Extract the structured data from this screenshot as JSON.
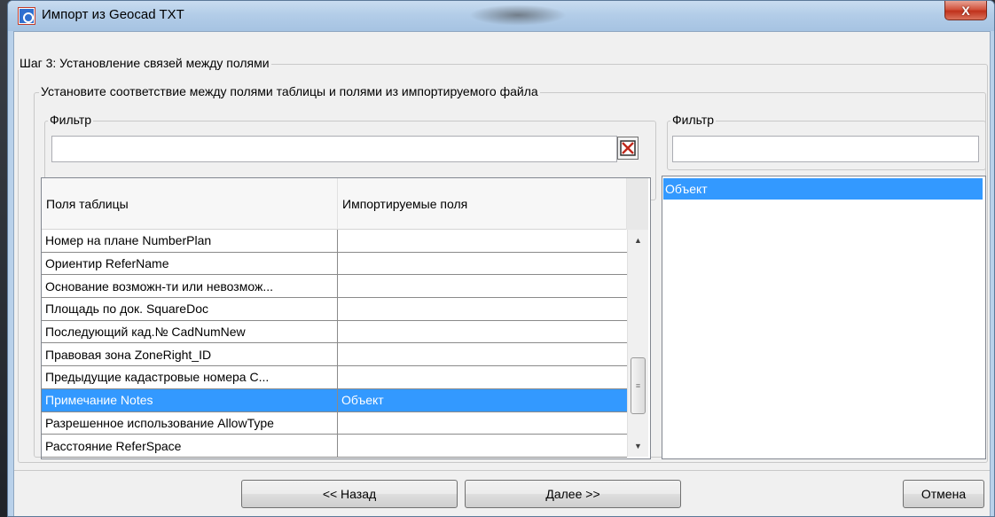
{
  "window": {
    "title": "Импорт из Geocad TXT",
    "close_label": "X"
  },
  "step": {
    "legend": "Шаг 3: Установление связей между полями"
  },
  "mapping": {
    "legend": "Установите соответствие между полями таблицы и полями из импортируемого файла"
  },
  "left_filter": {
    "legend": "Фильтр",
    "value": ""
  },
  "right_filter": {
    "legend": "Фильтр",
    "value": ""
  },
  "table": {
    "columns": [
      "Поля таблицы",
      "Импортируемые поля"
    ],
    "rows": [
      {
        "field": "Номер на плане NumberPlan",
        "import": ""
      },
      {
        "field": "Ориентир ReferName",
        "import": ""
      },
      {
        "field": "Основание возможн-ти или невозмож...",
        "import": ""
      },
      {
        "field": "Площадь по док. SquareDoc",
        "import": ""
      },
      {
        "field": "Последующий кад.№ CadNumNew",
        "import": ""
      },
      {
        "field": "Правовая зона ZoneRight_ID",
        "import": ""
      },
      {
        "field": "Предыдущие кадастровые номера C...",
        "import": ""
      },
      {
        "field": "Примечание Notes",
        "import": "Объект"
      },
      {
        "field": "Разрешенное использование AllowType",
        "import": ""
      },
      {
        "field": "Расстояние ReferSpace",
        "import": ""
      }
    ],
    "selected_row": 7
  },
  "import_list": {
    "items": [
      "Объект"
    ]
  },
  "buttons": {
    "back": "<< Назад",
    "next": "Далее >>",
    "cancel": "Отмена"
  }
}
